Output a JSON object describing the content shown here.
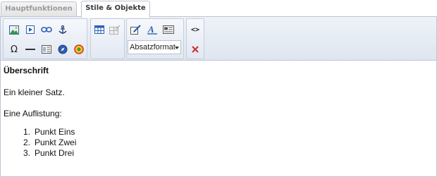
{
  "tabs": [
    {
      "label": "Hauptfunktionen",
      "active": false
    },
    {
      "label": "Stile & Objekte",
      "active": true
    }
  ],
  "toolbar": {
    "groups": [
      {
        "buttons": [
          "image-icon",
          "media-icon",
          "link-icon",
          "anchor-icon",
          "omega-icon",
          "horizontal-rule-icon",
          "template-icon",
          "navigator-icon",
          "flash-icon"
        ]
      },
      {
        "buttons": [
          "table-icon",
          "cell-props-icon"
        ]
      },
      {
        "buttons": [
          "style-edit-icon",
          "font-format-icon",
          "paragraph-box-icon"
        ]
      },
      {
        "buttons": [
          "code-view-icon",
          "remove-format-icon"
        ]
      }
    ],
    "format_select": {
      "value": "Absatzformat"
    },
    "icon_colors": {
      "accent_blue": "#2b5fb4",
      "red": "#d0302a",
      "green": "#3a9b3a"
    }
  },
  "content": {
    "heading": "Überschrift",
    "sentence": "Ein kleiner Satz.",
    "list_intro": "Eine Auflistung:",
    "list": [
      {
        "num": "1.",
        "text": "Punkt Eins"
      },
      {
        "num": "2.",
        "text": "Punkt Zwei"
      },
      {
        "num": "3.",
        "text": "Punkt Drei"
      }
    ]
  }
}
